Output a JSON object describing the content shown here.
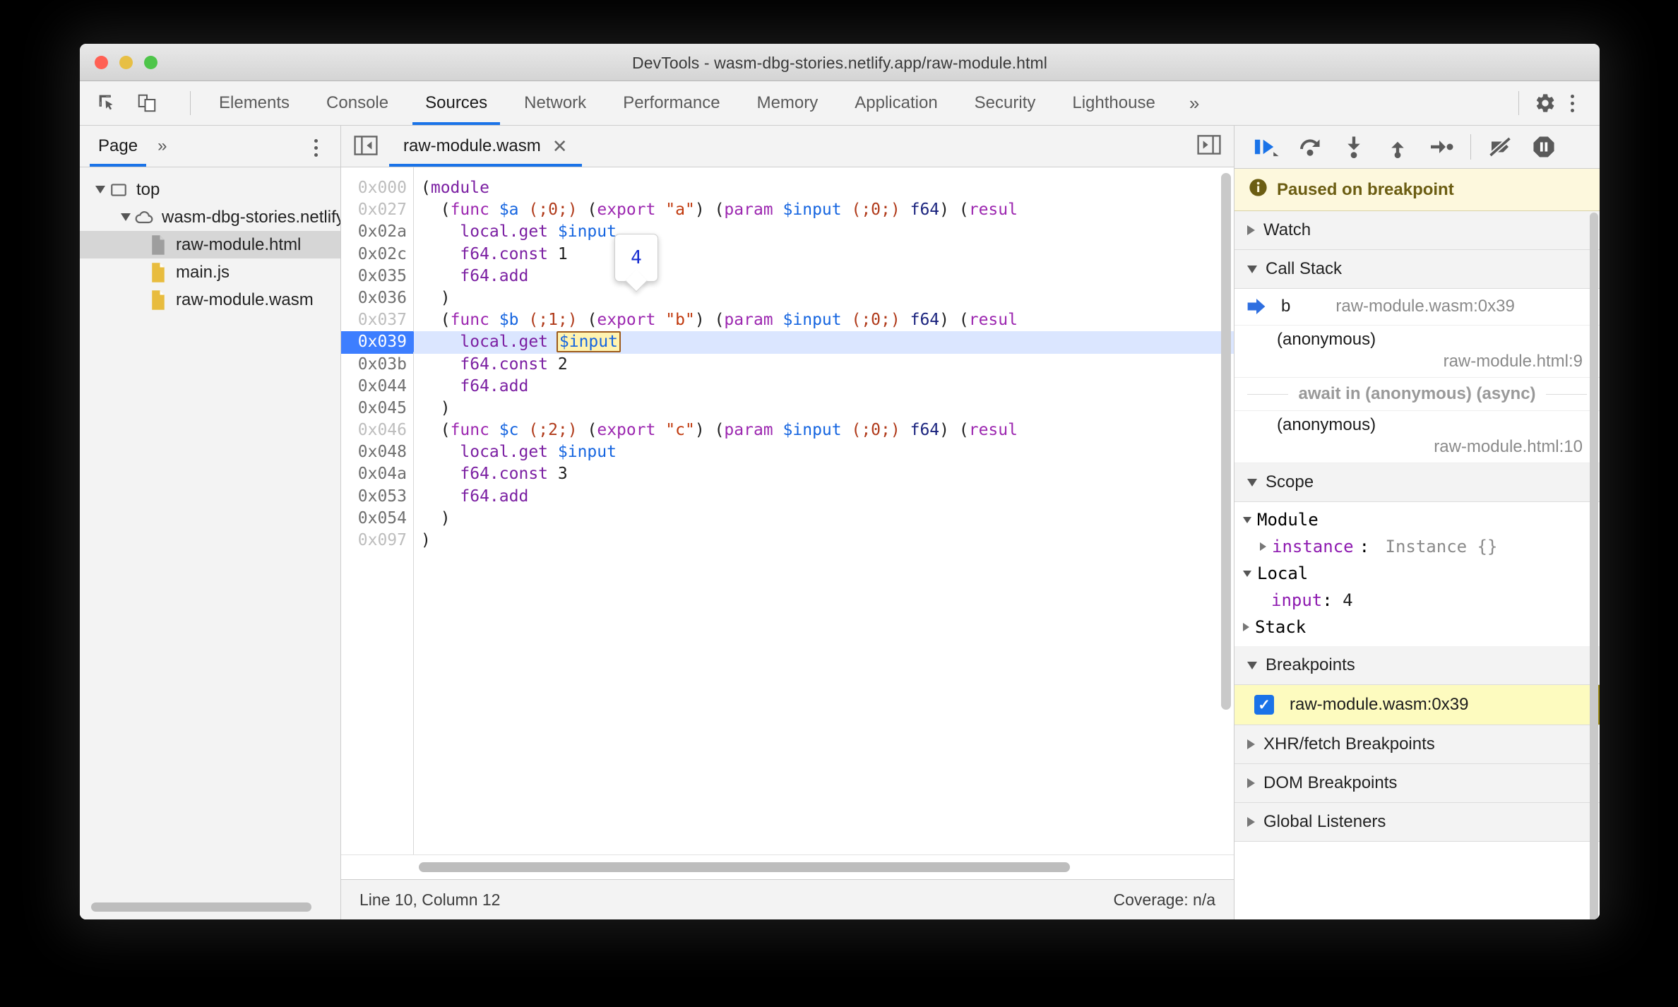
{
  "window": {
    "title": "DevTools - wasm-dbg-stories.netlify.app/raw-module.html"
  },
  "toolbar": {
    "inspect_icon": "inspect-cursor-icon",
    "device_icon": "device-toolbar-icon",
    "tabs": [
      {
        "label": "Elements",
        "active": false
      },
      {
        "label": "Console",
        "active": false
      },
      {
        "label": "Sources",
        "active": true
      },
      {
        "label": "Network",
        "active": false
      },
      {
        "label": "Performance",
        "active": false
      },
      {
        "label": "Memory",
        "active": false
      },
      {
        "label": "Application",
        "active": false
      },
      {
        "label": "Security",
        "active": false
      },
      {
        "label": "Lighthouse",
        "active": false
      }
    ],
    "overflow": "»",
    "settings_icon": "gear-icon",
    "menu_icon": "kebab-menu-icon"
  },
  "navigator": {
    "tab_label": "Page",
    "more_label": "»",
    "menu_icon": "kebab-menu-icon",
    "tree": [
      {
        "label": "top",
        "icon": "frame-icon",
        "depth": 0,
        "expanded": true,
        "selected": false
      },
      {
        "label": "wasm-dbg-stories.netlify",
        "icon": "cloud-icon",
        "depth": 1,
        "expanded": true,
        "selected": false
      },
      {
        "label": "raw-module.html",
        "icon": "document-icon",
        "depth": 2,
        "expanded": null,
        "selected": true
      },
      {
        "label": "main.js",
        "icon": "js-file-icon",
        "depth": 2,
        "expanded": null,
        "selected": false
      },
      {
        "label": "raw-module.wasm",
        "icon": "js-file-icon",
        "depth": 2,
        "expanded": null,
        "selected": false
      }
    ]
  },
  "editor": {
    "panel_toggle_icon": "show-navigator-icon",
    "tab_label": "raw-module.wasm",
    "tab_close_icon": "close-icon",
    "right_toggle_icon": "show-debugger-icon",
    "tooltip_value": "4",
    "lines": [
      {
        "addr": "0x000",
        "dim": true,
        "active": false,
        "text": "(module"
      },
      {
        "addr": "0x027",
        "dim": true,
        "active": false,
        "text": "  (func $a (;0;) (export \"a\") (param $input (;0;) f64) (resul"
      },
      {
        "addr": "0x02a",
        "dim": false,
        "active": false,
        "text": "    local.get $input"
      },
      {
        "addr": "0x02c",
        "dim": false,
        "active": false,
        "text": "    f64.const 1"
      },
      {
        "addr": "0x035",
        "dim": false,
        "active": false,
        "text": "    f64.add"
      },
      {
        "addr": "0x036",
        "dim": false,
        "active": false,
        "text": "  )"
      },
      {
        "addr": "0x037",
        "dim": true,
        "active": false,
        "text": "  (func $b (;1;) (export \"b\") (param $input (;0;) f64) (resul"
      },
      {
        "addr": "0x039",
        "dim": false,
        "active": true,
        "text": "    local.get $input"
      },
      {
        "addr": "0x03b",
        "dim": false,
        "active": false,
        "text": "    f64.const 2"
      },
      {
        "addr": "0x044",
        "dim": false,
        "active": false,
        "text": "    f64.add"
      },
      {
        "addr": "0x045",
        "dim": false,
        "active": false,
        "text": "  )"
      },
      {
        "addr": "0x046",
        "dim": true,
        "active": false,
        "text": "  (func $c (;2;) (export \"c\") (param $input (;0;) f64) (resul"
      },
      {
        "addr": "0x048",
        "dim": false,
        "active": false,
        "text": "    local.get $input"
      },
      {
        "addr": "0x04a",
        "dim": false,
        "active": false,
        "text": "    f64.const 3"
      },
      {
        "addr": "0x053",
        "dim": false,
        "active": false,
        "text": "    f64.add"
      },
      {
        "addr": "0x054",
        "dim": false,
        "active": false,
        "text": "  )"
      },
      {
        "addr": "0x097",
        "dim": true,
        "active": false,
        "text": ")"
      }
    ],
    "status_left": "Line 10, Column 12",
    "status_right": "Coverage: n/a"
  },
  "debugger": {
    "controls": [
      {
        "name": "resume-button",
        "icon": "resume-script-icon"
      },
      {
        "name": "step-over-button",
        "icon": "step-over-icon"
      },
      {
        "name": "step-into-button",
        "icon": "step-into-icon"
      },
      {
        "name": "step-out-button",
        "icon": "step-out-icon"
      },
      {
        "name": "step-button",
        "icon": "step-icon"
      },
      {
        "name": "deactivate-breakpoints-button",
        "icon": "deactivate-breakpoints-icon"
      },
      {
        "name": "pause-on-exceptions-button",
        "icon": "pause-on-exceptions-icon"
      }
    ],
    "paused_message": "Paused on breakpoint",
    "paused_icon": "info-icon",
    "sections": {
      "watch": {
        "label": "Watch",
        "expanded": false
      },
      "call_stack": {
        "label": "Call Stack",
        "expanded": true,
        "frames": [
          {
            "name": "b",
            "location": "raw-module.wasm:0x39",
            "selected": true,
            "inline": true
          },
          {
            "name": "(anonymous)",
            "location": "raw-module.html:9",
            "selected": false,
            "inline": false
          },
          {
            "name": "await in (anonymous) (async)",
            "location": "",
            "selected": false,
            "async": true
          },
          {
            "name": "(anonymous)",
            "location": "raw-module.html:10",
            "selected": false,
            "inline": false
          }
        ]
      },
      "scope": {
        "label": "Scope",
        "expanded": true,
        "groups": [
          {
            "label": "Module",
            "expanded": true,
            "depth": 0,
            "caret": "down"
          },
          {
            "label": "instance",
            "value": "Instance {}",
            "depth": 1,
            "caret": "right",
            "kind": "prop"
          },
          {
            "label": "Local",
            "expanded": true,
            "depth": 0,
            "caret": "down"
          },
          {
            "label": "input",
            "value": "4",
            "depth": 1,
            "caret": "none",
            "kind": "prop"
          },
          {
            "label": "Stack",
            "expanded": false,
            "depth": 0,
            "caret": "right"
          }
        ]
      },
      "breakpoints": {
        "label": "Breakpoints",
        "expanded": true,
        "items": [
          {
            "label": "raw-module.wasm:0x39",
            "checked": true
          }
        ]
      },
      "xhr_breakpoints": {
        "label": "XHR/fetch Breakpoints",
        "expanded": false
      },
      "dom_breakpoints": {
        "label": "DOM Breakpoints",
        "expanded": false
      },
      "global_listeners": {
        "label": "Global Listeners",
        "expanded": false
      }
    }
  },
  "colors": {
    "accent": "#1a73e8",
    "paused_bg": "#fdf8dd",
    "breakpoint_bg": "#fdfbbf",
    "active_line_gutter": "#3d7eff",
    "active_line_bg": "#dbe6ff"
  }
}
